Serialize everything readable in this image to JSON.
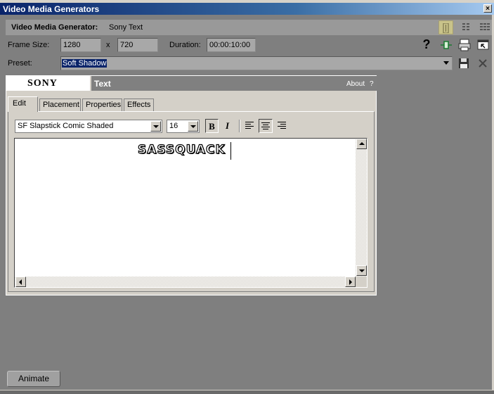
{
  "window": {
    "title": "Video Media Generators",
    "close_glyph": "×"
  },
  "generator": {
    "label": "Video Media Generator:",
    "name": "Sony Text"
  },
  "frame_size": {
    "label": "Frame Size:",
    "width": "1280",
    "separator": "x",
    "height": "720"
  },
  "duration": {
    "label": "Duration:",
    "value": "00:00:10:00"
  },
  "preset": {
    "label": "Preset:",
    "value": "Soft Shadow"
  },
  "toolbar": {
    "help_glyph": "?"
  },
  "plugin": {
    "logo": "SONY",
    "title": "Text",
    "about": "About",
    "about_q": "?"
  },
  "tabs": [
    {
      "label": "Edit"
    },
    {
      "label": "Placement"
    },
    {
      "label": "Properties"
    },
    {
      "label": "Effects"
    }
  ],
  "format": {
    "font": "SF Slapstick Comic Shaded",
    "size": "16",
    "bold": "B",
    "italic": "I",
    "alignment": "center"
  },
  "editor": {
    "text": "SASSQUACK"
  },
  "animate_button": "Animate"
}
